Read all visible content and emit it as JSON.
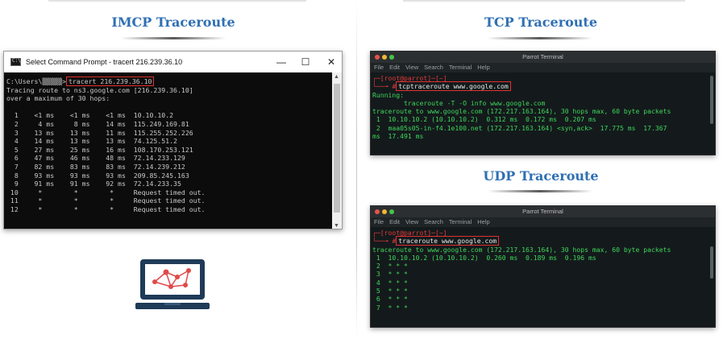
{
  "headings": {
    "icmp": "IMCP Traceroute",
    "tcp": "TCP Traceroute",
    "udp": "UDP Traceroute"
  },
  "cmd": {
    "window_title": "Select Command Prompt - tracert  216.239.36.10",
    "controls": {
      "minimize": "—",
      "maximize": "☐",
      "close": "✕"
    },
    "prompt": "C:\\Users\\▒▒▒▒▒>",
    "command": "tracert 216.239.36.10",
    "lines": [
      "Tracing route to ns3.google.com [216.239.36.10]",
      "over a maximum of 30 hops:",
      "",
      "  1    <1 ms    <1 ms    <1 ms  10.10.10.2",
      "  2     4 ms     8 ms    14 ms  115.249.169.81",
      "  3    13 ms    13 ms    11 ms  115.255.252.226",
      "  4    14 ms    13 ms    13 ms  74.125.51.2",
      "  5    27 ms    25 ms    16 ms  108.170.253.121",
      "  6    47 ms    46 ms    48 ms  72.14.233.129",
      "  7    82 ms    83 ms    83 ms  72.14.239.212",
      "  8    93 ms    93 ms    93 ms  209.85.245.163",
      "  9    91 ms    91 ms    92 ms  72.14.233.35",
      " 10     *        *        *     Request timed out.",
      " 11     *        *        *     Request timed out.",
      " 12     *        *        *     Request timed out."
    ]
  },
  "tcp_terminal": {
    "title": "Parrot Terminal",
    "menu": [
      "File",
      "Edit",
      "View",
      "Search",
      "Terminal",
      "Help"
    ],
    "prompt_line": "┌─[root@parrot]─[~]",
    "prompt_arrow": "└──╼ #",
    "command": "tcptraceroute www.google.com",
    "lines": [
      "Running:",
      "        traceroute -T -O info www.google.com",
      "traceroute to www.google.com (172.217.163.164), 30 hops max, 60 byte packets",
      " 1  10.10.10.2 (10.10.10.2)  0.312 ms  0.172 ms  0.207 ms",
      " 2  maa05s05-in-f4.1e100.net (172.217.163.164) <syn,ack>  17.775 ms  17.367",
      "ms  17.491 ms"
    ]
  },
  "udp_terminal": {
    "title": "Parrot Terminal",
    "menu": [
      "File",
      "Edit",
      "View",
      "Search",
      "Terminal",
      "Help"
    ],
    "prompt_line": "┌─[root@parrot]─[~]",
    "prompt_arrow": "└──╼ #",
    "command": "traceroute www.google.com",
    "lines": [
      "traceroute to www.google.com (172.217.163.164), 30 hops max, 60 byte packets",
      " 1  10.10.10.2 (10.10.10.2)  0.260 ms  0.189 ms  0.196 ms",
      " 2  * * *",
      " 3  * * *",
      " 4  * * *",
      " 5  * * *",
      " 6  * * *",
      " 7  * * *"
    ]
  },
  "colors": {
    "heading_blue": "#2f6fb3",
    "terminal_green": "#3ed65a",
    "highlight_red": "#e03030",
    "laptop_navy": "#1f3b57",
    "network_red": "#e04a4a"
  },
  "icons": [
    "cmd-app-icon",
    "window-minimize-icon",
    "window-maximize-icon",
    "window-close-icon",
    "laptop-network-icon"
  ]
}
